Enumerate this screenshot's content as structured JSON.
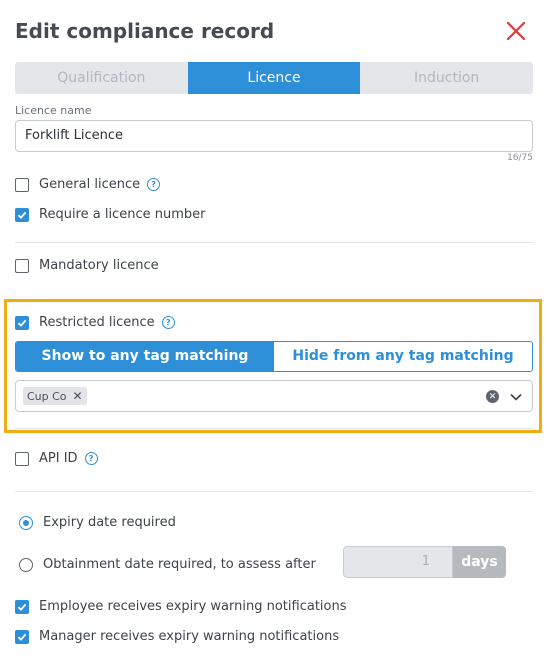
{
  "header": {
    "title": "Edit compliance record",
    "close_color": "#e2393b"
  },
  "tabs": [
    {
      "label": "Qualification",
      "active": false
    },
    {
      "label": "Licence",
      "active": true
    },
    {
      "label": "Induction",
      "active": false
    }
  ],
  "licence_name": {
    "label": "Licence name",
    "value": "Forklift Licence",
    "counter": "16/75"
  },
  "options": {
    "general": {
      "label": "General licence",
      "checked": false
    },
    "require_number": {
      "label": "Require a licence number",
      "checked": true
    },
    "mandatory": {
      "label": "Mandatory licence",
      "checked": false
    },
    "restricted": {
      "label": "Restricted licence",
      "checked": true
    },
    "api_id": {
      "label": "API ID",
      "checked": false
    }
  },
  "restriction": {
    "show_label": "Show to any tag matching",
    "hide_label": "Hide from any tag matching",
    "selected": "show",
    "tags": [
      "Cup Co"
    ]
  },
  "date_mode": {
    "expiry_label": "Expiry date required",
    "obtainment_label": "Obtainment date required, to assess after",
    "selected": "expiry",
    "days_value": "1",
    "days_unit": "days"
  },
  "notifications": {
    "employee": {
      "label": "Employee receives expiry warning notifications",
      "checked": true
    },
    "manager": {
      "label": "Manager receives expiry warning notifications",
      "checked": true
    }
  },
  "colors": {
    "accent": "#2d8fd8",
    "highlight": "#f2ad13"
  }
}
